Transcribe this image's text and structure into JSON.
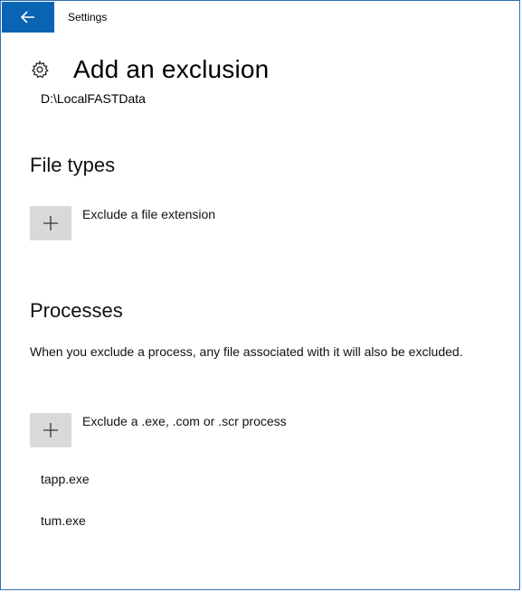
{
  "window": {
    "title": "Settings",
    "accent": "#0a64b4",
    "border": "#2f6db3"
  },
  "icons": {
    "back": "back-arrow-icon",
    "settings": "gear-icon",
    "add": "plus-icon"
  },
  "page": {
    "title": "Add an exclusion",
    "path": "D:\\LocalFASTData"
  },
  "file_types": {
    "heading": "File types",
    "add_label": "Exclude a file extension"
  },
  "processes": {
    "heading": "Processes",
    "description": "When you exclude a process, any file associated with it will also be excluded.",
    "add_label": "Exclude a .exe, .com or .scr process",
    "items": [
      {
        "name": "tapp.exe"
      },
      {
        "name": "tum.exe"
      }
    ]
  }
}
